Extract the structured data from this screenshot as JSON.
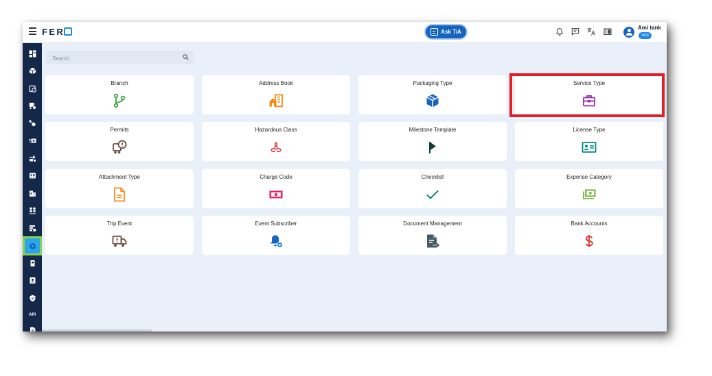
{
  "header": {
    "logo_text": "FER",
    "ask_button": "Ask TiA",
    "user_name": "Ami tank",
    "user_badge": "Ami",
    "brand_color": "#1565c0"
  },
  "sidebar": {
    "items": [
      {
        "icon": "dashboard-icon"
      },
      {
        "icon": "package-icon"
      },
      {
        "icon": "calendar-clock-icon"
      },
      {
        "icon": "truck-settings-icon"
      },
      {
        "icon": "nodes-icon"
      },
      {
        "icon": "money-list-icon"
      },
      {
        "icon": "transfer-icon"
      },
      {
        "icon": "cash-register-icon"
      },
      {
        "icon": "building-icon"
      },
      {
        "icon": "people-icon"
      },
      {
        "icon": "shipping-settings-icon"
      },
      {
        "icon": "settings-gear-icon",
        "active": true
      },
      {
        "icon": "bin-icon"
      },
      {
        "icon": "contacts-icon"
      },
      {
        "icon": "shield-icon"
      },
      {
        "icon": "api-icon",
        "text": "API"
      },
      {
        "icon": "document-icon"
      }
    ]
  },
  "search": {
    "placeholder": "Search"
  },
  "tiles": [
    {
      "title": "Branch",
      "icon": "branch-icon",
      "color": "#3aa53e"
    },
    {
      "title": "Address Book",
      "icon": "address-book-icon",
      "color": "#f28c1a"
    },
    {
      "title": "Packaging Type",
      "icon": "package-box-icon",
      "color": "#1565c0"
    },
    {
      "title": "Service Type",
      "icon": "toolbox-icon",
      "color": "#9c27b0"
    },
    {
      "title": "Permits",
      "icon": "permit-truck-icon",
      "color": "#6d4c41"
    },
    {
      "title": "Hazardous Class",
      "icon": "biohazard-icon",
      "color": "#e53935"
    },
    {
      "title": "Milestone Template",
      "icon": "flag-icon",
      "color": "#0f3d3a"
    },
    {
      "title": "License Type",
      "icon": "license-card-icon",
      "color": "#00897b"
    },
    {
      "title": "Attachment Type",
      "icon": "file-text-icon",
      "color": "#f28c1a"
    },
    {
      "title": "Charge Code",
      "icon": "banknote-icon",
      "color": "#e91e63"
    },
    {
      "title": "Checklist",
      "icon": "check-icon",
      "color": "#00897b"
    },
    {
      "title": "Expense Category",
      "icon": "cash-stack-icon",
      "color": "#7cb342"
    },
    {
      "title": "Trip Event",
      "icon": "trip-truck-icon",
      "color": "#6d4c41"
    },
    {
      "title": "Event Subscriber",
      "icon": "bell-gear-icon",
      "color": "#1565c0"
    },
    {
      "title": "Document Management",
      "icon": "document-export-icon",
      "color": "#455a64"
    },
    {
      "title": "Bank Accounts",
      "icon": "dollar-icon",
      "color": "#e53935"
    }
  ],
  "highlight": {
    "tile": "Service Type",
    "color": "#e31e24"
  }
}
